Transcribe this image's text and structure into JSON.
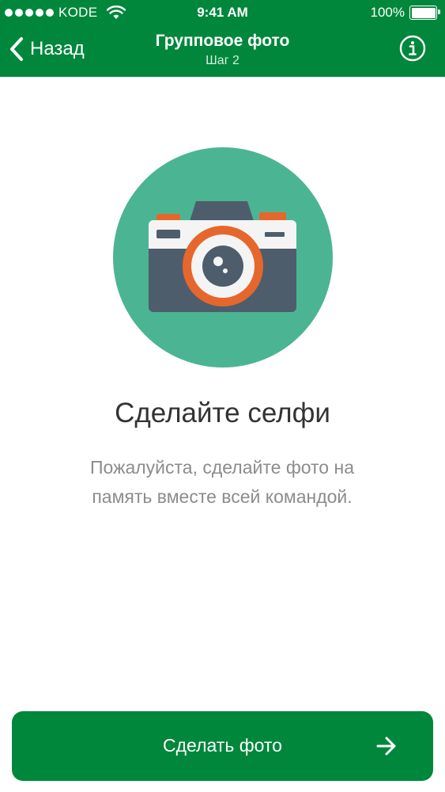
{
  "status_bar": {
    "carrier": "KODE",
    "time": "9:41 AM",
    "battery": "100%"
  },
  "nav": {
    "back_label": "Назад",
    "title": "Групповое фото",
    "subtitle": "Шаг 2",
    "back_icon": "chevron-left-icon",
    "info_icon": "info-icon"
  },
  "content": {
    "illustration_icon": "camera-icon",
    "headline": "Сделайте селфи",
    "description": "Пожалуйста, сделайте фото на память вместе всей командой."
  },
  "action": {
    "label": "Сделать фото",
    "icon": "arrow-right-icon"
  },
  "colors": {
    "brand_green": "#00873c",
    "circle_teal": "#4bb593",
    "camera_dark": "#4e5d6c",
    "camera_orange": "#e5672c",
    "text_dark": "#333333",
    "text_muted": "#8c8c8c"
  }
}
